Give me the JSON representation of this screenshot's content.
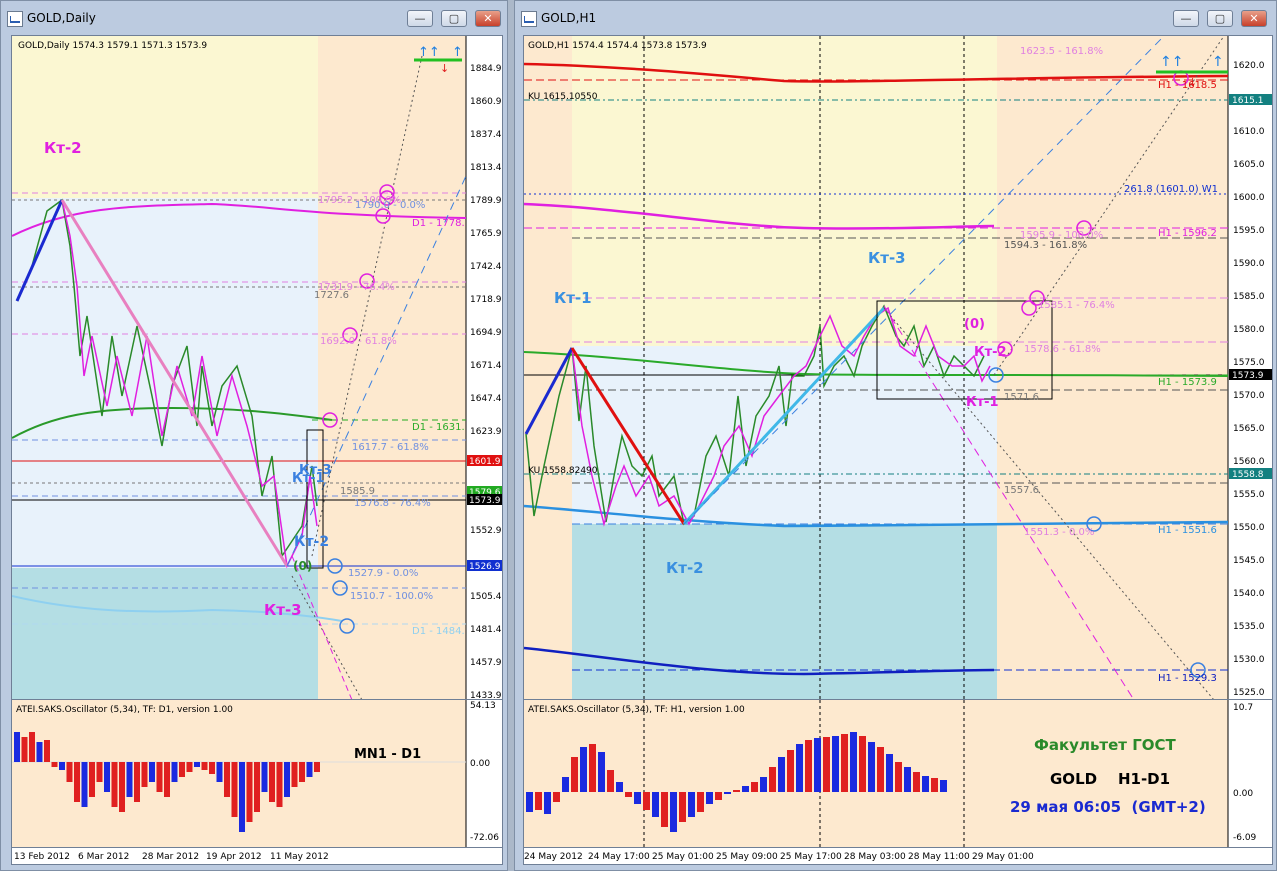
{
  "left": {
    "window_title": "GOLD,Daily",
    "header": "GOLD,Daily  1574.3 1579.1 1571.3 1573.9",
    "price_ticks": [
      "1884.9",
      "1860.9",
      "1837.4",
      "1813.4",
      "1789.9",
      "1765.9",
      "1742.4",
      "1718.9",
      "1694.9",
      "1671.4",
      "1647.4",
      "1623.9",
      "1552.9",
      "1505.4",
      "1481.4",
      "1457.9",
      "1433.9"
    ],
    "price_boxes": [
      {
        "label": "1601.9",
        "color": "#e01010"
      },
      {
        "label": "1579.6",
        "color": "#22aa22"
      },
      {
        "label": "1573.9",
        "color": "#000000"
      },
      {
        "label": "1526.9",
        "color": "#1030d0"
      }
    ],
    "fib_labels": [
      "1795.2 - 100.0%",
      "1790.0 - 0.0%",
      "1731.9 - 76.4%",
      "1727.6",
      "1692.0 - 61.8%",
      "1617.7 - 61.8%",
      "1585.9",
      "1576.8 - 76.4%",
      "1527.9 - 0.0%",
      "1510.7 - 100.0%"
    ],
    "ma_labels": [
      "D1 - 1778.",
      "D1 - 1631.",
      "D1 - 1484."
    ],
    "wave_labels": [
      "Кт-2",
      "Кт-3",
      "Кт-1",
      "Кт-3",
      "Кт-2",
      "(0)"
    ],
    "dates": [
      "13 Feb 2012",
      "6 Mar 2012",
      "28 Mar 2012",
      "19 Apr 2012",
      "11 May 2012"
    ],
    "oscillator": {
      "title": "ATEI.SAKS.Oscillator (5,34), TF: D1, version 1.00",
      "ticks": [
        "54.13",
        "0.00",
        "-72.06"
      ],
      "note": "MN1 - D1"
    }
  },
  "right": {
    "window_title": "GOLD,H1",
    "header": "GOLD,H1  1574.4 1574.4 1573.8 1573.9",
    "price_ticks": [
      "1620.0",
      "1610.0",
      "1605.0",
      "1600.0",
      "1595.0",
      "1590.0",
      "1585.0",
      "1580.0",
      "1575.0",
      "1570.0",
      "1565.0",
      "1560.0",
      "1555.0",
      "1550.0",
      "1545.0",
      "1540.0",
      "1535.0",
      "1530.0",
      "1525.0"
    ],
    "price_boxes": [
      {
        "label": "1615.1",
        "color": "#138080"
      },
      {
        "label": "1573.9",
        "color": "#000000"
      },
      {
        "label": "1558.8",
        "color": "#138080"
      }
    ],
    "ku_labels": [
      "KU 1615.10550",
      "KU 1558.82490"
    ],
    "fib_labels": [
      "1623.5 - 161.8%",
      "261.8 (1601.0) W1",
      "1595.9 - 100.0%",
      "1594.3 - 161.8%",
      "1585.1 - 76.4%",
      "1578.6 - 61.8%",
      "1571.6",
      "1557.6",
      "1551.3 - 0.0%"
    ],
    "ma_labels": [
      "H1 - 1618.5",
      "H1 - 1596.2",
      "H1 - 1573.9",
      "H1 - 1551.6",
      "H1 - 1529.3"
    ],
    "wave_labels": [
      "Кт-1",
      "Кт-3",
      "Кт-2",
      "(0)",
      "Кт-2",
      "Кт-1"
    ],
    "dates": [
      "24 May 2012",
      "24 May 17:00",
      "25 May 01:00",
      "25 May 09:00",
      "25 May 17:00",
      "28 May 03:00",
      "28 May 11:00",
      "29 May 01:00"
    ],
    "oscillator": {
      "title": "ATEI.SAKS.Oscillator (5,34), TF: H1, version 1.00",
      "ticks": [
        "10.7",
        "0.00",
        "-6.09"
      ]
    },
    "caption": {
      "line1": "Факультет ГОСТ",
      "line2": "GOLD    H1-D1",
      "line3": "29 мая 06:05  (GMT+2)"
    }
  },
  "colors": {
    "green": "#2a8a2a",
    "magenta": "#e020e0",
    "blue": "#2090e0",
    "red": "#e01010",
    "navy": "#1020c0",
    "bg_fill": "#fde9cf",
    "yellow_fill": "#fbf7d2",
    "lightblue_fill": "#e8f2fb",
    "teal_fill": "#b4dee4"
  }
}
